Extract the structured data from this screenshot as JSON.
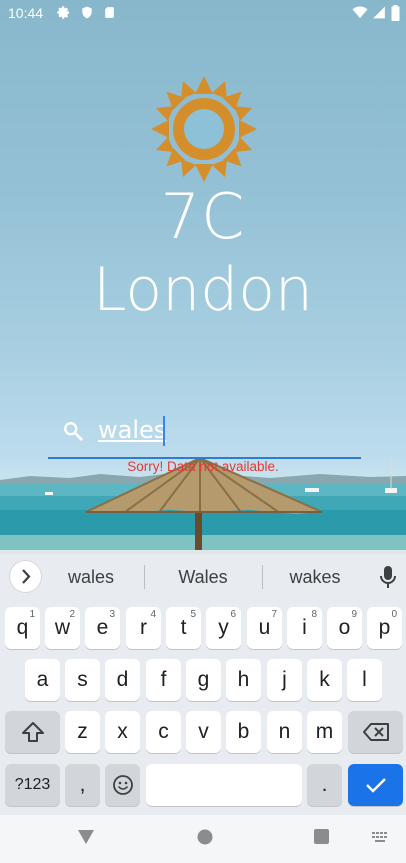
{
  "status_bar": {
    "time": "10:44",
    "icons": [
      "gear-icon",
      "shield-icon",
      "sd-card-icon",
      "wifi-icon",
      "signal-icon",
      "battery-icon"
    ]
  },
  "weather": {
    "icon": "sun-icon",
    "temperature": "7C",
    "city": "London"
  },
  "search": {
    "value": "wales",
    "error": "Sorry! Data not available."
  },
  "keyboard": {
    "suggestions": [
      "wales",
      "Wales",
      "wakes"
    ],
    "row1": [
      {
        "label": "q",
        "hint": "1"
      },
      {
        "label": "w",
        "hint": "2"
      },
      {
        "label": "e",
        "hint": "3"
      },
      {
        "label": "r",
        "hint": "4"
      },
      {
        "label": "t",
        "hint": "5"
      },
      {
        "label": "y",
        "hint": "6"
      },
      {
        "label": "u",
        "hint": "7"
      },
      {
        "label": "i",
        "hint": "8"
      },
      {
        "label": "o",
        "hint": "9"
      },
      {
        "label": "p",
        "hint": "0"
      }
    ],
    "row2": [
      "a",
      "s",
      "d",
      "f",
      "g",
      "h",
      "j",
      "k",
      "l"
    ],
    "row3": [
      "z",
      "x",
      "c",
      "v",
      "b",
      "n",
      "m"
    ],
    "symbols_label": "?123",
    "comma_label": ",",
    "period_label": "."
  },
  "colors": {
    "sun": "#d48e2c",
    "accent": "#1a73e8",
    "error": "#e53935"
  }
}
